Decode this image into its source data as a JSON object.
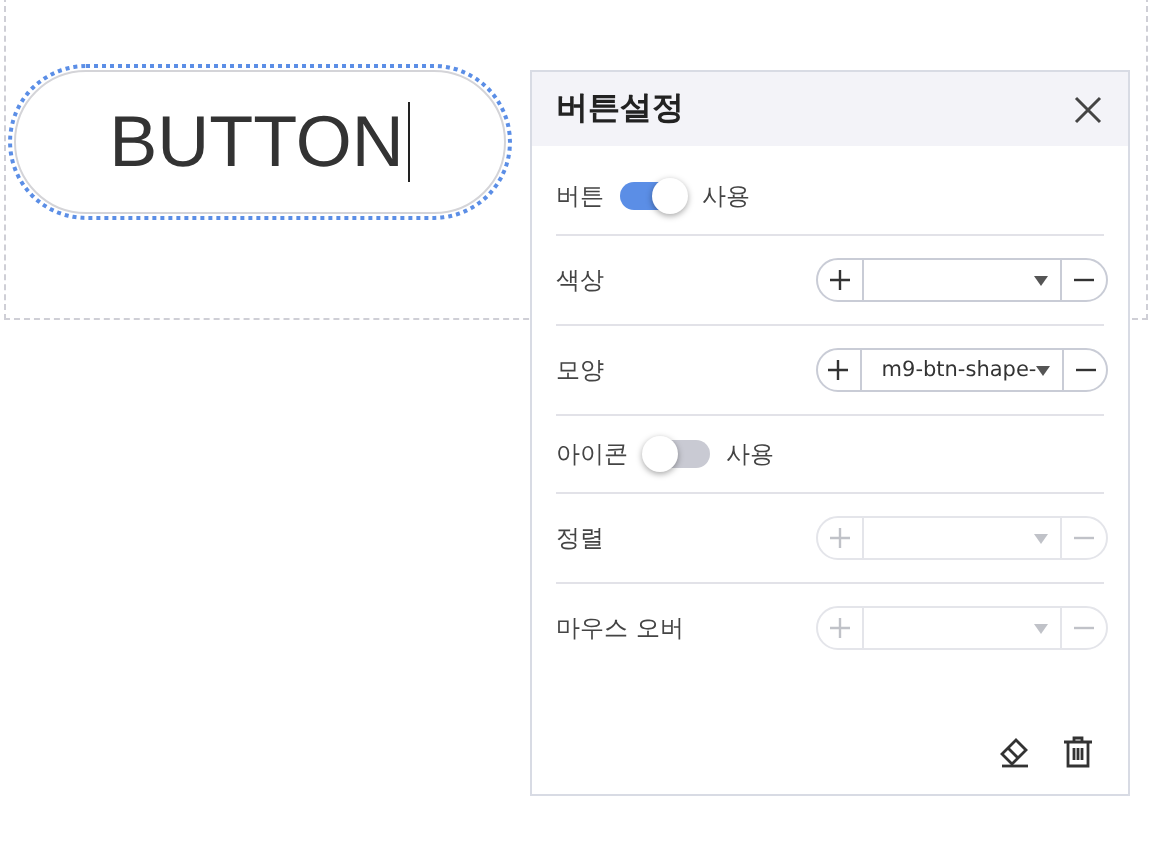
{
  "canvas": {
    "button": {
      "label": "BUTTON",
      "selected": true
    }
  },
  "panel": {
    "title": "버튼설정",
    "rows": [
      {
        "kind": "toggle",
        "label": "버튼",
        "on": true,
        "option": "사용"
      },
      {
        "kind": "select",
        "label": "색상",
        "disabled": false
      },
      {
        "kind": "select",
        "label": "모양",
        "value": "m9-btn-shape-",
        "disabled": false
      },
      {
        "kind": "toggle",
        "label": "아이콘",
        "on": false,
        "option": "사용"
      },
      {
        "kind": "select",
        "label": "정렬",
        "disabled": true
      },
      {
        "kind": "select",
        "label": "마우스 오버",
        "disabled": true
      }
    ]
  }
}
